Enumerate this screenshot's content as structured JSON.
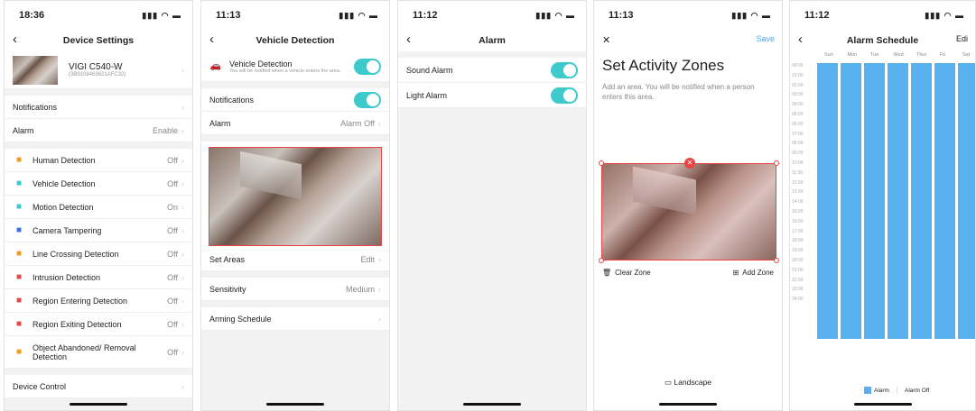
{
  "screen1": {
    "time": "18:36",
    "title": "Device Settings",
    "device_name": "VIGI C540-W",
    "device_id": "(3B9108463621AFC32)",
    "notifications": "Notifications",
    "alarm_label": "Alarm",
    "alarm_value": "Enable",
    "items": [
      {
        "label": "Human Detection",
        "value": "Off",
        "icon": "person-icon",
        "color": "#f39a1e"
      },
      {
        "label": "Vehicle Detection",
        "value": "Off",
        "icon": "car-icon",
        "color": "#3ec9cc"
      },
      {
        "label": "Motion Detection",
        "value": "On",
        "icon": "running-person-icon",
        "color": "#3ec9cc"
      },
      {
        "label": "Camera Tampering",
        "value": "Off",
        "icon": "eye-icon",
        "color": "#3b6fe0"
      },
      {
        "label": "Line Crossing Detection",
        "value": "Off",
        "icon": "line-crossing-icon",
        "color": "#f39a1e"
      },
      {
        "label": "Intrusion Detection",
        "value": "Off",
        "icon": "intrusion-icon",
        "color": "#e84545"
      },
      {
        "label": "Region Entering Detection",
        "value": "Off",
        "icon": "region-enter-icon",
        "color": "#e84545"
      },
      {
        "label": "Region Exiting Detection",
        "value": "Off",
        "icon": "region-exit-icon",
        "color": "#e84545"
      },
      {
        "label": "Object Abandoned/ Removal Detection",
        "value": "Off",
        "icon": "object-icon",
        "color": "#f39a1e"
      }
    ],
    "device_control": "Device Control"
  },
  "screen2": {
    "time": "11:13",
    "title": "Vehicle Detection",
    "vd_title": "Vehicle Detection",
    "vd_desc": "You will be notified when a vehicle enters the area.",
    "notifications": "Notifications",
    "alarm_label": "Alarm",
    "alarm_value": "Alarm Off",
    "set_areas": "Set Areas",
    "edit": "Edit",
    "sensitivity": "Sensitivity",
    "sensitivity_value": "Medium",
    "arming": "Arming Schedule"
  },
  "screen3": {
    "time": "11:12",
    "title": "Alarm",
    "sound": "Sound Alarm",
    "light": "Light Alarm"
  },
  "screen4": {
    "time": "11:13",
    "save": "Save",
    "heading": "Set Activity Zones",
    "desc": "Add an area. You will be notified when a person enters this area.",
    "clear": "Clear Zone",
    "add": "Add Zone",
    "landscape": "Landscape"
  },
  "screen5": {
    "time": "11:12",
    "title": "Alarm Schedule",
    "edit": "Edi",
    "days": [
      "Sun",
      "Mon",
      "Tue",
      "Wed",
      "Thur",
      "Fri",
      "Sat"
    ],
    "hours": [
      "00:00",
      "01:00",
      "02:00",
      "03:00",
      "04:00",
      "05:00",
      "06:00",
      "07:00",
      "08:00",
      "09:00",
      "10:00",
      "11:00",
      "12:00",
      "13:00",
      "14:00",
      "15:00",
      "16:00",
      "17:00",
      "18:00",
      "19:00",
      "20:00",
      "21:00",
      "22:00",
      "23:00",
      "24:00"
    ],
    "legend_alarm": "Alarm",
    "legend_off": "Alarm Off",
    "accent": "#5ab1f0"
  }
}
